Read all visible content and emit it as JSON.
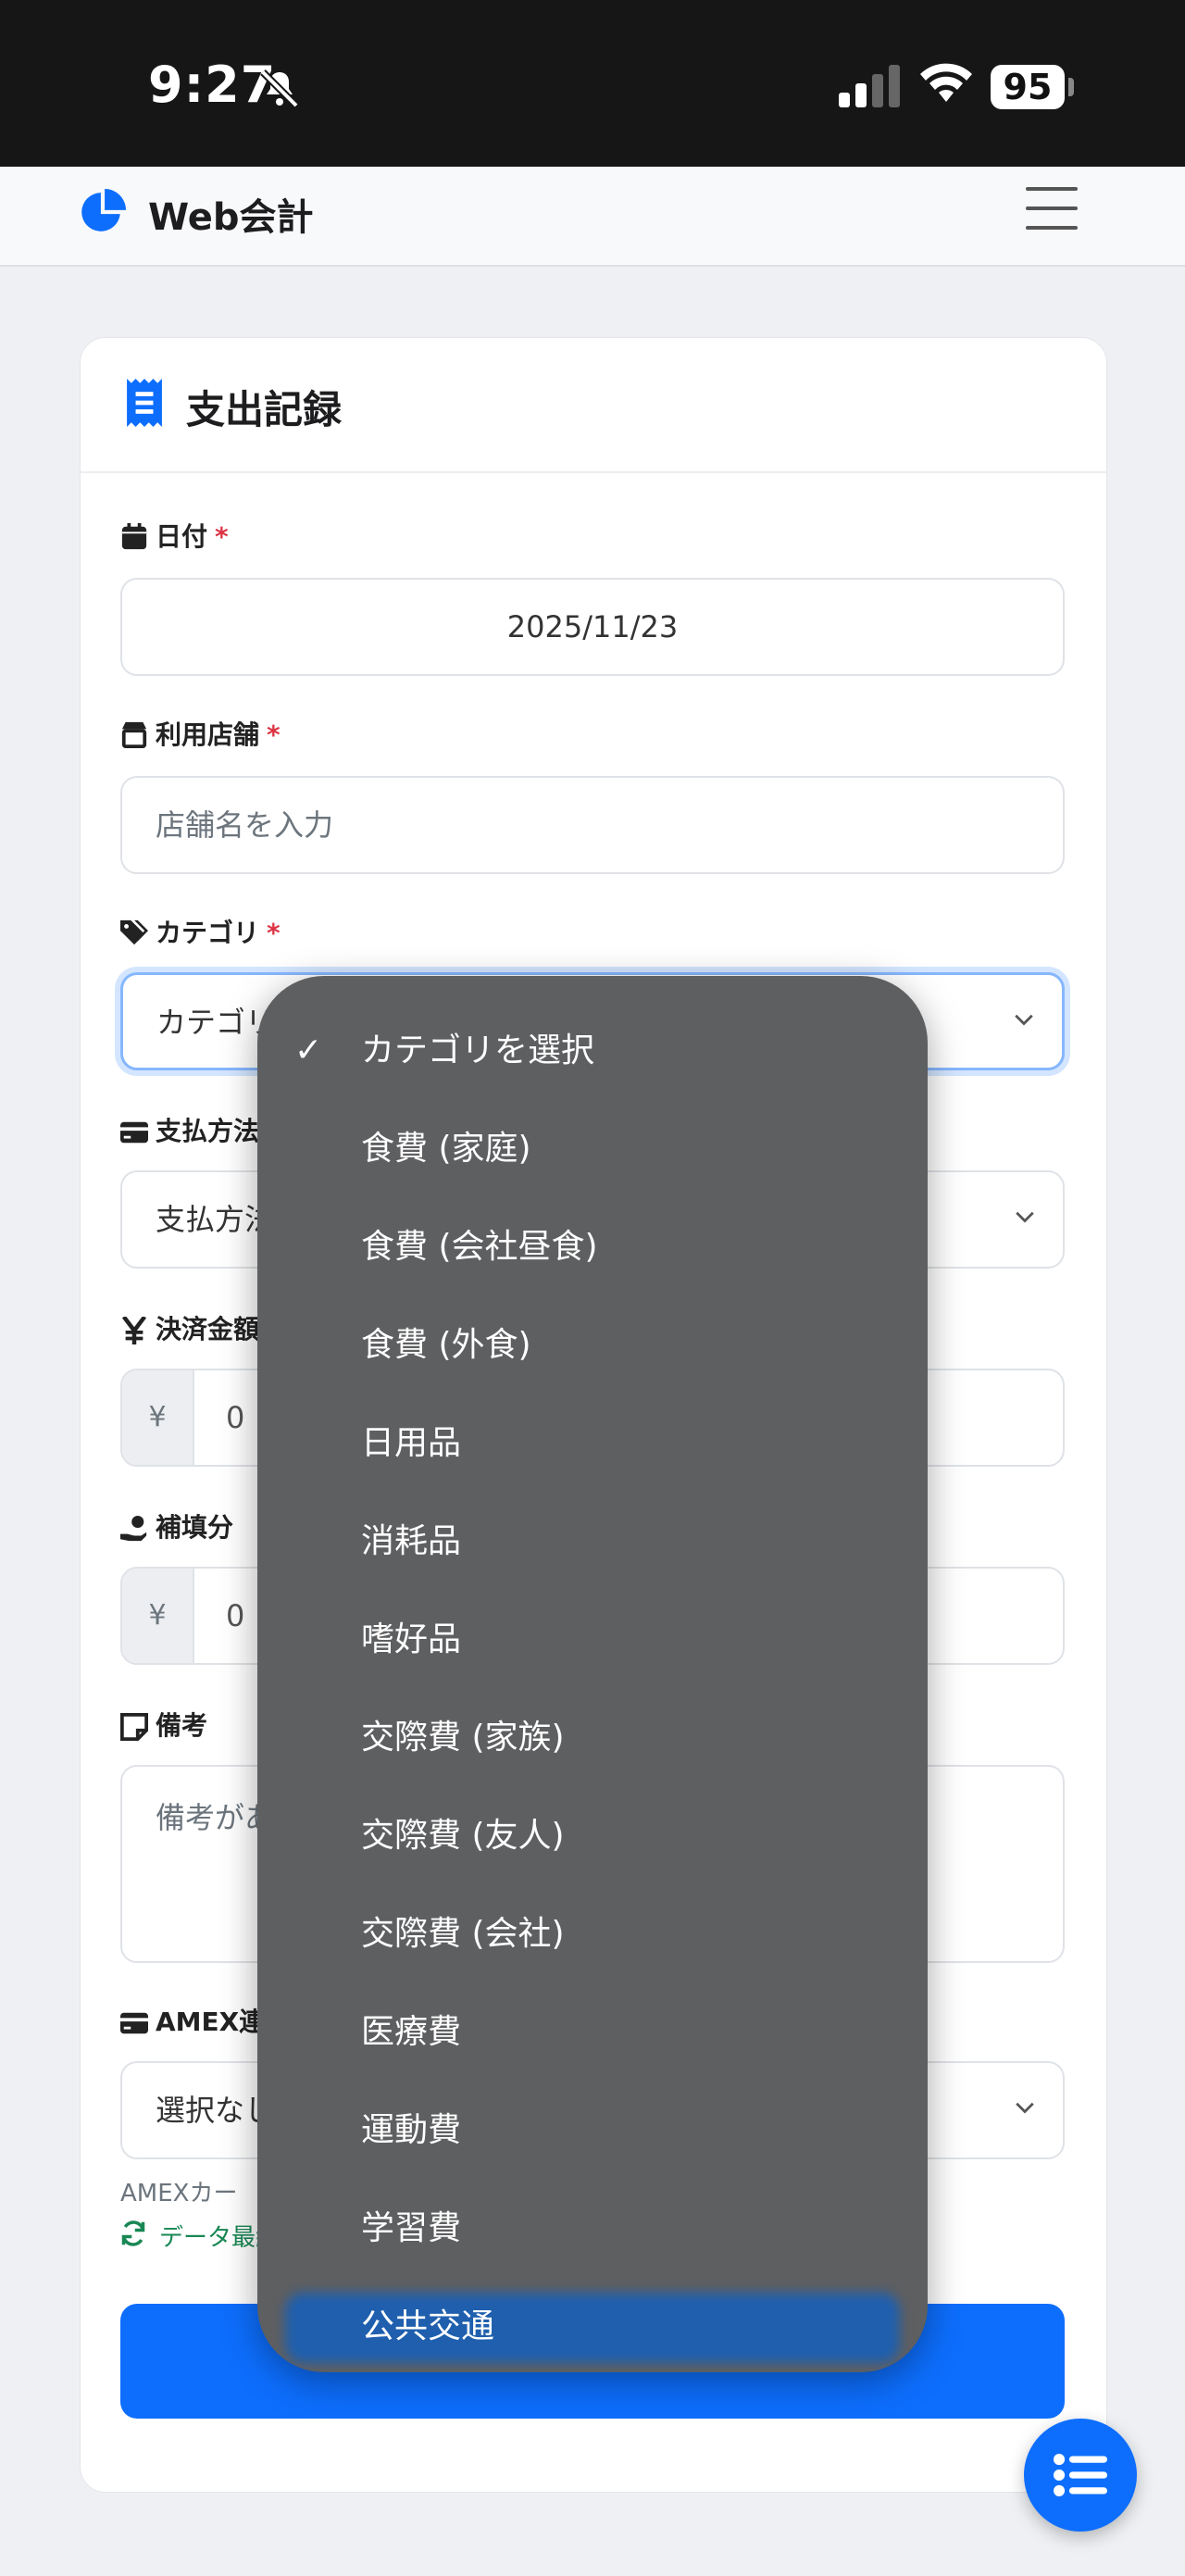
{
  "status_bar": {
    "time": "9:27",
    "battery": "95",
    "icons": [
      "bell-slash-icon",
      "cellular-signal-icon",
      "wifi-icon",
      "battery-icon"
    ]
  },
  "navbar": {
    "brand": "Web会計",
    "brand_icon": "pie-chart-icon",
    "menu_icon": "hamburger-icon"
  },
  "card": {
    "title": "支出記録",
    "title_icon": "receipt-icon"
  },
  "form": {
    "date": {
      "label": "日付",
      "required": "*",
      "value": "2025/11/23",
      "icon": "calendar-icon"
    },
    "store": {
      "label": "利用店舗",
      "required": "*",
      "placeholder": "店舗名を入力",
      "icon": "shop-icon"
    },
    "category": {
      "label": "カテゴリ",
      "required": "*",
      "selected": "カテゴリ",
      "icon": "tags-icon"
    },
    "payment": {
      "label": "支払方法",
      "selected": "支払方法",
      "icon": "credit-card-icon"
    },
    "amount": {
      "label": "決済金額",
      "addon": "¥",
      "value": "0",
      "icon": "yen-icon"
    },
    "compensation": {
      "label": "補填分",
      "addon": "¥",
      "value": "0",
      "icon": "hand-coin-icon"
    },
    "memo": {
      "label": "備考",
      "placeholder": "備考があ",
      "icon": "sticky-note-icon"
    },
    "amex": {
      "label": "AMEX連",
      "selected": "選択なし",
      "icon": "credit-card-icon",
      "helper": "AMEXカー",
      "sync": "データ最終"
    }
  },
  "fab": {
    "icon": "list-icon"
  },
  "dropdown": {
    "options": [
      {
        "label": "カテゴリを選択",
        "checked": true
      },
      {
        "label": "食費 (家庭)"
      },
      {
        "label": "食費 (会社昼食)"
      },
      {
        "label": "食費 (外食)"
      },
      {
        "label": "日用品"
      },
      {
        "label": "消耗品"
      },
      {
        "label": "嗜好品"
      },
      {
        "label": "交際費 (家族)"
      },
      {
        "label": "交際費 (友人)"
      },
      {
        "label": "交際費 (会社)"
      },
      {
        "label": "医療費"
      },
      {
        "label": "運動費"
      },
      {
        "label": "学習費"
      },
      {
        "label": "公共交通",
        "highlighted": true
      }
    ],
    "check_mark": "✓"
  }
}
